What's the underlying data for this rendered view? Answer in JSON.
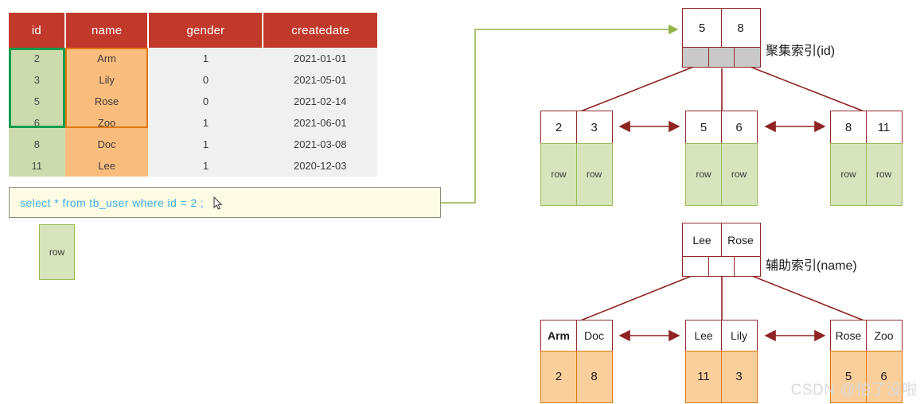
{
  "table": {
    "headers": [
      "id",
      "name",
      "gender",
      "createdate"
    ],
    "rows": [
      {
        "id": "2",
        "name": "Arm",
        "gender": "1",
        "createdate": "2021-01-01"
      },
      {
        "id": "3",
        "name": "Lily",
        "gender": "0",
        "createdate": "2021-05-01"
      },
      {
        "id": "5",
        "name": "Rose",
        "gender": "0",
        "createdate": "2021-02-14"
      },
      {
        "id": "6",
        "name": "Zoo",
        "gender": "1",
        "createdate": "2021-06-01"
      },
      {
        "id": "8",
        "name": "Doc",
        "gender": "1",
        "createdate": "2021-03-08"
      },
      {
        "id": "11",
        "name": "Lee",
        "gender": "1",
        "createdate": "2020-12-03"
      }
    ],
    "header_bg": "#c0392b",
    "id_col_bg": "#ccdbae",
    "id_col_border": "#0f9c4f",
    "name_col_bg": "#fbbd7d",
    "name_col_border": "#dd7a12"
  },
  "sql": {
    "text": "select * from tb_user where id = 2 ;",
    "box_bg": "#fdfbe4",
    "text_color": "#38aee0"
  },
  "result_row": {
    "label": "row"
  },
  "clustered": {
    "caption": "聚集索引(id)",
    "root": {
      "keys": [
        "5",
        "8"
      ],
      "pointer_count": 3
    },
    "leaves": [
      {
        "keys": [
          "2",
          "3"
        ],
        "values": [
          "row",
          "row"
        ]
      },
      {
        "keys": [
          "5",
          "6"
        ],
        "values": [
          "row",
          "row"
        ]
      },
      {
        "keys": [
          "8",
          "11"
        ],
        "values": [
          "row",
          "row"
        ]
      }
    ]
  },
  "secondary": {
    "caption": "辅助索引(name)",
    "root": {
      "keys": [
        "Lee",
        "Rose"
      ],
      "pointer_count": 3
    },
    "leaves": [
      {
        "keys": [
          "Arm",
          "Doc"
        ],
        "values": [
          "2",
          "8"
        ],
        "highlight_key_index": 0
      },
      {
        "keys": [
          "Lee",
          "Lily"
        ],
        "values": [
          "11",
          "3"
        ],
        "highlight_key_index": -1
      },
      {
        "keys": [
          "Rose",
          "Zoo"
        ],
        "values": [
          "5",
          "6"
        ],
        "highlight_key_index": -1
      }
    ]
  },
  "colors": {
    "node_border": "#932b2b",
    "arrow_red": "#8f2222",
    "arrow_green": "#94b44a",
    "leaf_green_fill": "#d7e4bc",
    "leaf_orange_fill": "#fbcf9c"
  },
  "watermark": {
    "text": "CSDN @怕了没啦"
  }
}
